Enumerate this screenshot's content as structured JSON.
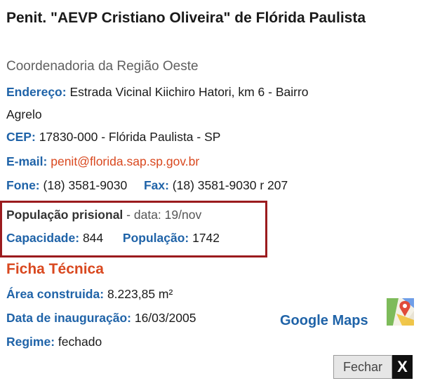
{
  "title": "Penit. \"AEVP Cristiano Oliveira\" de Flórida Paulista",
  "subtitle": "Coordenadoria da Região Oeste",
  "address": {
    "label": "Endereço:",
    "line1": "Estrada Vicinal Kiichiro Hatori, km 6 - Bairro",
    "line2": "Agrelo"
  },
  "cep": {
    "label": "CEP:",
    "value": "17830-000 - Flórida Paulista - SP"
  },
  "email": {
    "label": "E-mail:",
    "value": "penit@florida.sap.sp.gov.br"
  },
  "phone": {
    "fone_label": "Fone:",
    "fone_value": "(18) 3581-9030",
    "fax_label": "Fax:",
    "fax_value": "(18) 3581-9030 r 207"
  },
  "population": {
    "title": "População prisional",
    "date_text": "- data: 19/nov",
    "capacity_label": "Capacidade:",
    "capacity_value": "844",
    "population_label": "População:",
    "population_value": "1742"
  },
  "ficha": {
    "heading": "Ficha Técnica",
    "area_label": "Área construida:",
    "area_value": "8.223,85 m²",
    "inauguration_label": "Data de inauguração:",
    "inauguration_value": "16/03/2005",
    "regime_label": "Regime:",
    "regime_value": "fechado"
  },
  "google_maps": {
    "label": "Google Maps",
    "icon": "google-maps-icon"
  },
  "close_button": {
    "label": "Fechar",
    "x": "X"
  },
  "colors": {
    "label_blue": "#1f63a8",
    "accent_orange": "#d9481f",
    "box_border": "#9b1b1e"
  }
}
